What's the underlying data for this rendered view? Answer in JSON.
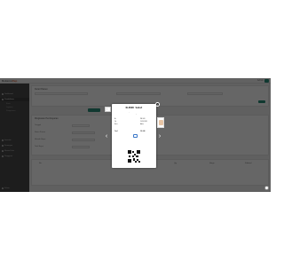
{
  "app": {
    "logo_text": "Rekamo",
    "logo_accent": "Rep",
    "user_text": "Admin"
  },
  "sidebar": {
    "items": [
      {
        "label": "Dashboard"
      },
      {
        "label": "Pendaftaran"
      },
      {
        "label": "Kasir"
      },
      {
        "label": "Laporan"
      },
      {
        "label": "Pengaturan"
      },
      {
        "label": "Inventori"
      },
      {
        "label": "Keuangan"
      },
      {
        "label": "Master Data"
      },
      {
        "label": "Pengguna"
      },
      {
        "label": "Keluar"
      }
    ]
  },
  "content": {
    "info_title": "Detail Pasien",
    "form_title": "Ringkasan Pembayaran",
    "fields": [
      "Tanggal",
      "Nama Pasien",
      "Metode Bayar",
      "Total Bayar"
    ],
    "table_headers": [
      "No",
      "Item",
      "Qty",
      "Harga",
      "Subtotal"
    ],
    "pay_button": "Bayar",
    "print_button": "Cetak"
  },
  "receipt": {
    "title": "KLINIK Sehat",
    "address_lines": [
      "Jl. Merdeka No. 12",
      "Telp. 0812-3456-7890",
      "Bandung"
    ],
    "separator": "--------------------------",
    "rows": [
      {
        "k": "No",
        "v": "INV-001"
      },
      {
        "k": "Tgl",
        "v": "12/05/2023"
      },
      {
        "k": "Kasir",
        "v": "Admin"
      }
    ],
    "total_label": "Total",
    "total_value": "150.000",
    "thanks": "Terima Kasih"
  },
  "icons": {
    "close": "×",
    "prev": "‹",
    "next": "›"
  },
  "colors": {
    "sidebar_bg": "#4a4a4a",
    "accent_green": "#2a8c79",
    "overlay": "rgba(0,0,0,0.6)"
  }
}
